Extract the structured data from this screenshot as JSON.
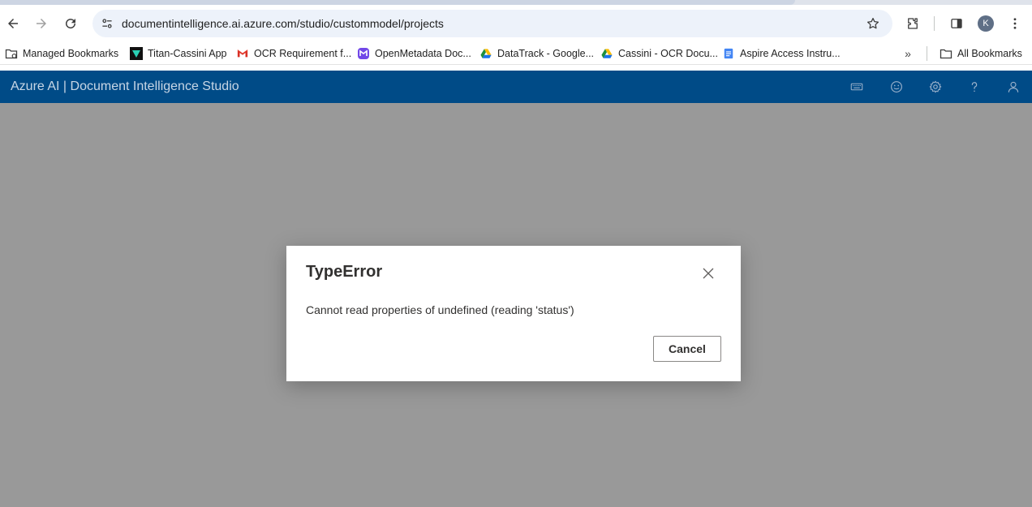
{
  "browser": {
    "url": "documentintelligence.ai.azure.com/studio/custommodel/projects",
    "avatar_initial": "K",
    "bookmarks": [
      {
        "label": "Managed Bookmarks",
        "icon": "folder-gear-icon"
      },
      {
        "label": "Titan-Cassini App",
        "icon": "titan-logo-icon"
      },
      {
        "label": "OCR Requirement f...",
        "icon": "gmail-icon"
      },
      {
        "label": "OpenMetadata Doc...",
        "icon": "openmetadata-icon"
      },
      {
        "label": "DataTrack - Google...",
        "icon": "google-drive-icon"
      },
      {
        "label": "Cassini - OCR Docu...",
        "icon": "google-drive-icon"
      },
      {
        "label": "Aspire Access Instru...",
        "icon": "google-docs-icon"
      }
    ],
    "more_bookmarks_glyph": "»",
    "all_bookmarks_label": "All Bookmarks"
  },
  "app": {
    "title": "Azure AI | Document Intelligence Studio",
    "header_bg": "#004b87",
    "header_icons": [
      "keyboard-icon",
      "smiley-icon",
      "settings-icon",
      "help-icon",
      "user-icon"
    ]
  },
  "dialog": {
    "title": "TypeError",
    "message": "Cannot read properties of undefined (reading 'status')",
    "cancel_label": "Cancel"
  }
}
